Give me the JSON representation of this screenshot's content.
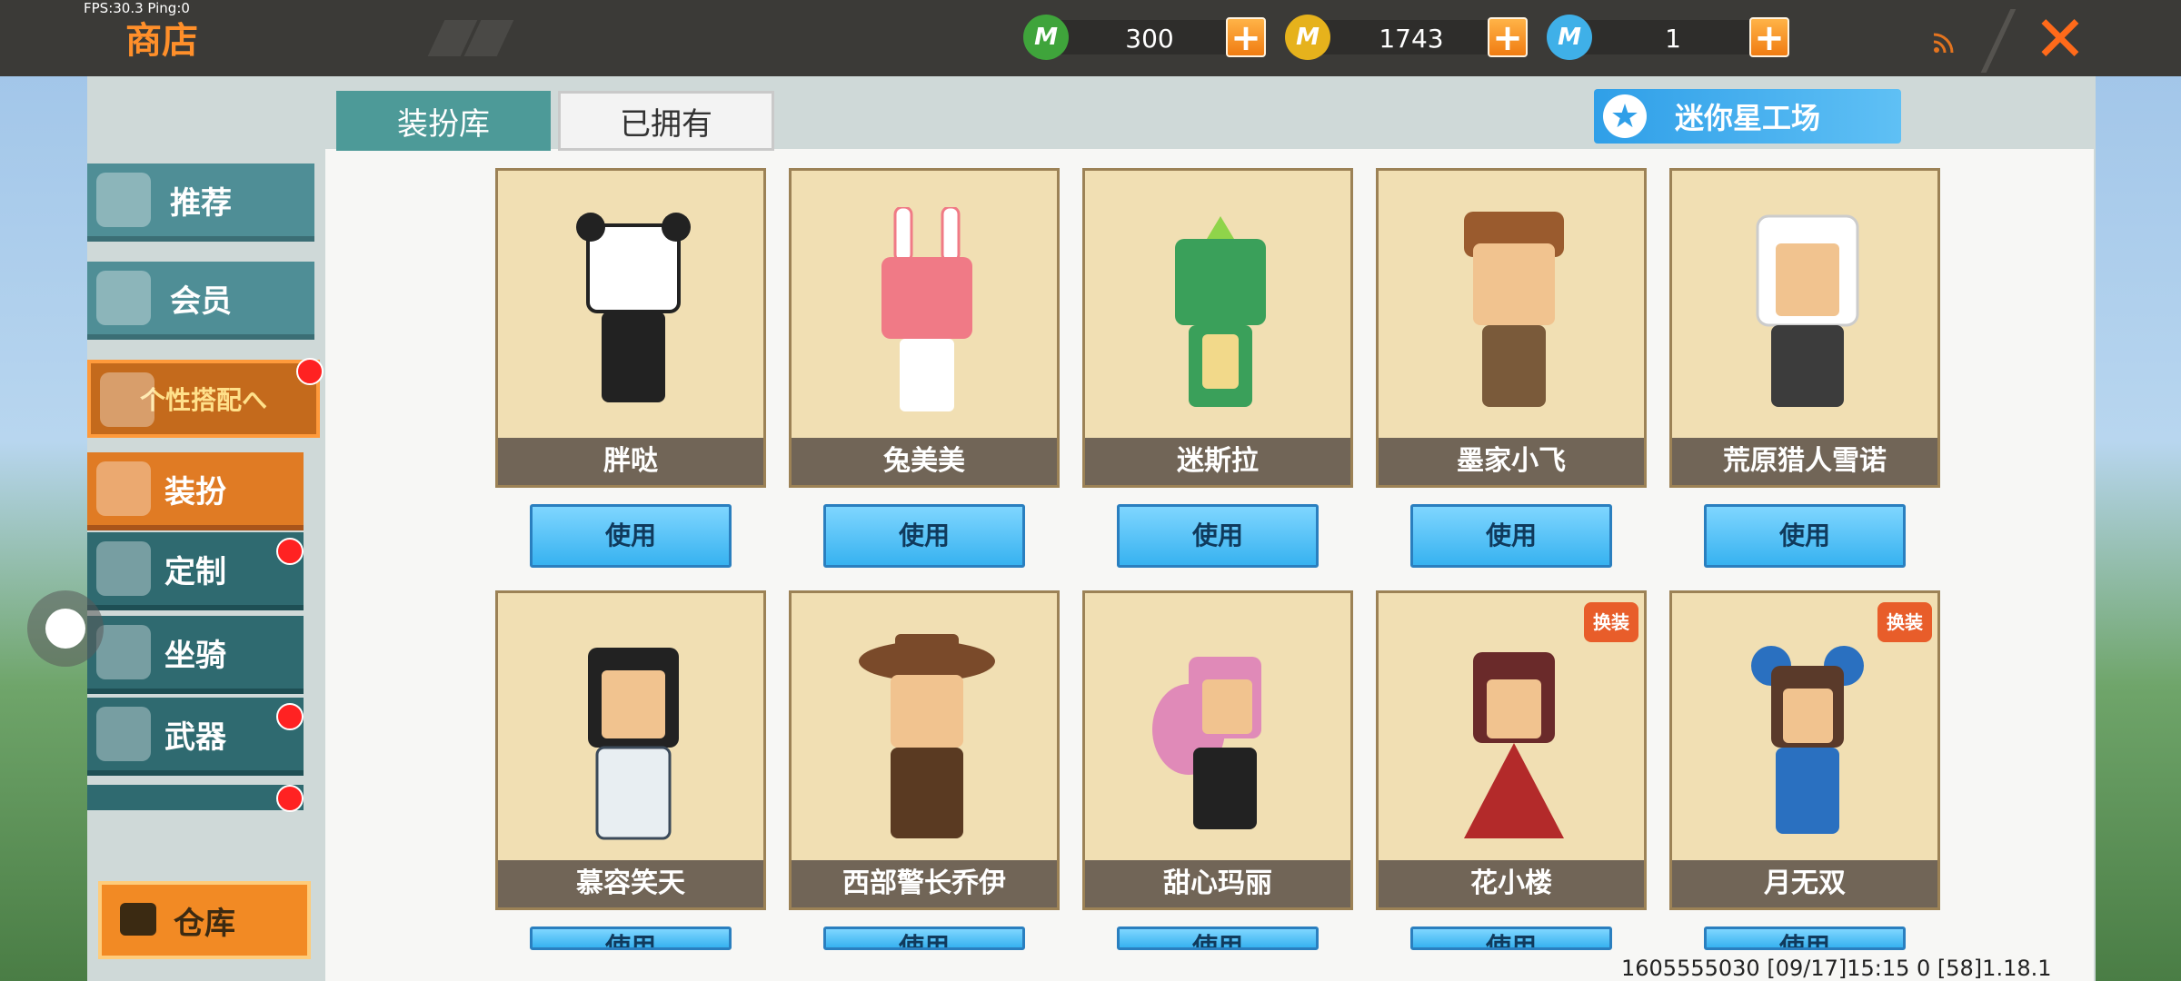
{
  "status": {
    "fps_text": "FPS:30.3  Ping:0"
  },
  "header": {
    "title": "商店",
    "currencies": [
      {
        "icon": "green-m-coin-icon",
        "value": "300",
        "color": "#3fa43b"
      },
      {
        "icon": "gold-m-coin-icon",
        "value": "1743",
        "color": "#e6b21c"
      },
      {
        "icon": "blue-m-coin-icon",
        "value": "1",
        "color": "#3fb0e8"
      }
    ]
  },
  "tabs": {
    "active": "装扮库",
    "idle": "已拥有"
  },
  "workshop_label": "迷你星工场",
  "sidebar": {
    "items": [
      {
        "label": "推荐"
      },
      {
        "label": "会员"
      },
      {
        "label": "个性搭配へ"
      },
      {
        "label": "装扮"
      },
      {
        "label": "定制"
      },
      {
        "label": "坐骑"
      },
      {
        "label": "武器"
      }
    ],
    "warehouse": "仓库"
  },
  "cards": [
    {
      "name": "胖哒",
      "use": "使用",
      "color": "#ffffff",
      "badge": ""
    },
    {
      "name": "兔美美",
      "use": "使用",
      "color": "#f07a86",
      "badge": ""
    },
    {
      "name": "迷斯拉",
      "use": "使用",
      "color": "#3aa05a",
      "badge": ""
    },
    {
      "name": "墨家小飞",
      "use": "使用",
      "color": "#9a5b2e",
      "badge": ""
    },
    {
      "name": "荒原猎人雪诺",
      "use": "使用",
      "color": "#3c3c3c",
      "badge": ""
    },
    {
      "name": "慕容笑天",
      "use": "使用",
      "color": "#3b4a5a",
      "badge": ""
    },
    {
      "name": "西部警长乔伊",
      "use": "使用",
      "color": "#7a4a2a",
      "badge": ""
    },
    {
      "name": "甜心玛丽",
      "use": "使用",
      "color": "#e08ab8",
      "badge": ""
    },
    {
      "name": "花小楼",
      "use": "使用",
      "color": "#b32a2a",
      "badge": "换装"
    },
    {
      "name": "月无双",
      "use": "使用",
      "color": "#2a70c0",
      "badge": "换装"
    }
  ],
  "footer_info": "1605555030  [09/17]15:15 0    [58]1.18.1"
}
